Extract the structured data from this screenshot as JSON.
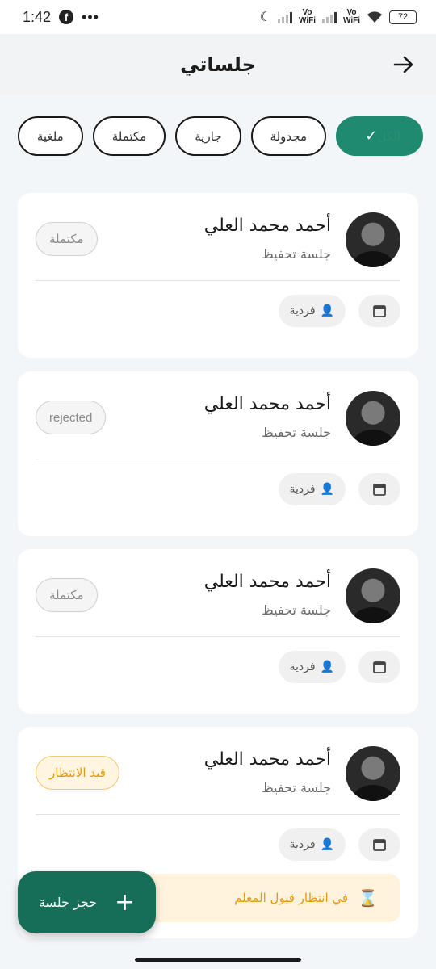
{
  "status_bar": {
    "time": "1:42",
    "battery": "72",
    "network": "Vo WiFi"
  },
  "header": {
    "title": "جلساتي",
    "back_icon": "arrow-right-icon"
  },
  "filters": [
    {
      "label": "الكل",
      "active": true
    },
    {
      "label": "مجدولة",
      "active": false
    },
    {
      "label": "جارية",
      "active": false
    },
    {
      "label": "مكتملة",
      "active": false
    },
    {
      "label": "ملغية",
      "active": false
    }
  ],
  "sessions": [
    {
      "name": "أحمد محمد العلي",
      "type": "جلسة تحفيظ",
      "status": "مكتملة",
      "kind": "فردية"
    },
    {
      "name": "أحمد محمد العلي",
      "type": "جلسة تحفيظ",
      "status": "rejected",
      "kind": "فردية"
    },
    {
      "name": "أحمد محمد العلي",
      "type": "جلسة تحفيظ",
      "status": "مكتملة",
      "kind": "فردية"
    },
    {
      "name": "أحمد محمد العلي",
      "type": "جلسة تحفيظ",
      "status": "قيد الانتظار",
      "kind": "فردية",
      "notice": "في انتظار قبول المعلم"
    }
  ],
  "fab": {
    "label": "حجز جلسة"
  },
  "colors": {
    "primary": "#1f8a6f",
    "pending": "#e49a0a"
  }
}
